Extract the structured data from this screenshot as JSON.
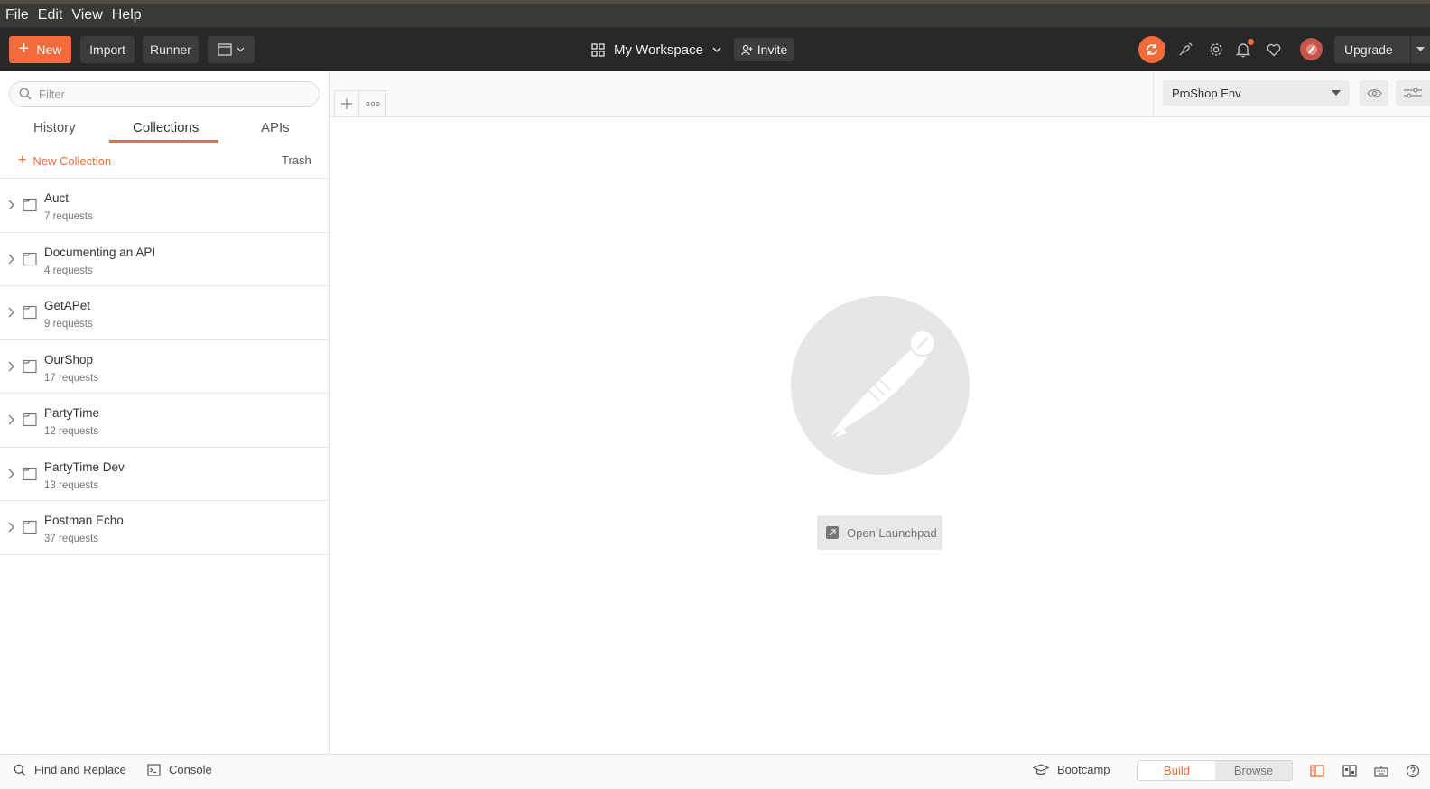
{
  "menubar": {
    "items": [
      "File",
      "Edit",
      "View",
      "Help"
    ]
  },
  "toolbar": {
    "new_label": "New",
    "import_label": "Import",
    "runner_label": "Runner",
    "workspace_label": "My Workspace",
    "invite_label": "Invite",
    "upgrade_label": "Upgrade",
    "accent_color": "#f26b3a"
  },
  "sidebar": {
    "filter_placeholder": "Filter",
    "tabs": [
      {
        "label": "History",
        "active": false
      },
      {
        "label": "Collections",
        "active": true
      },
      {
        "label": "APIs",
        "active": false
      }
    ],
    "new_collection_label": "New Collection",
    "trash_label": "Trash",
    "collections": [
      {
        "name": "Auct",
        "count": "7 requests"
      },
      {
        "name": "Documenting an API",
        "count": "4 requests"
      },
      {
        "name": "GetAPet",
        "count": "9 requests"
      },
      {
        "name": "OurShop",
        "count": "17 requests"
      },
      {
        "name": "PartyTime",
        "count": "12 requests"
      },
      {
        "name": "PartyTime Dev",
        "count": "13 requests"
      },
      {
        "name": "Postman Echo",
        "count": "37 requests"
      }
    ]
  },
  "environment": {
    "selected": "ProShop Env"
  },
  "main": {
    "launchpad_label": "Open Launchpad"
  },
  "statusbar": {
    "find_replace_label": "Find and Replace",
    "console_label": "Console",
    "bootcamp_label": "Bootcamp",
    "build_label": "Build",
    "browse_label": "Browse"
  }
}
